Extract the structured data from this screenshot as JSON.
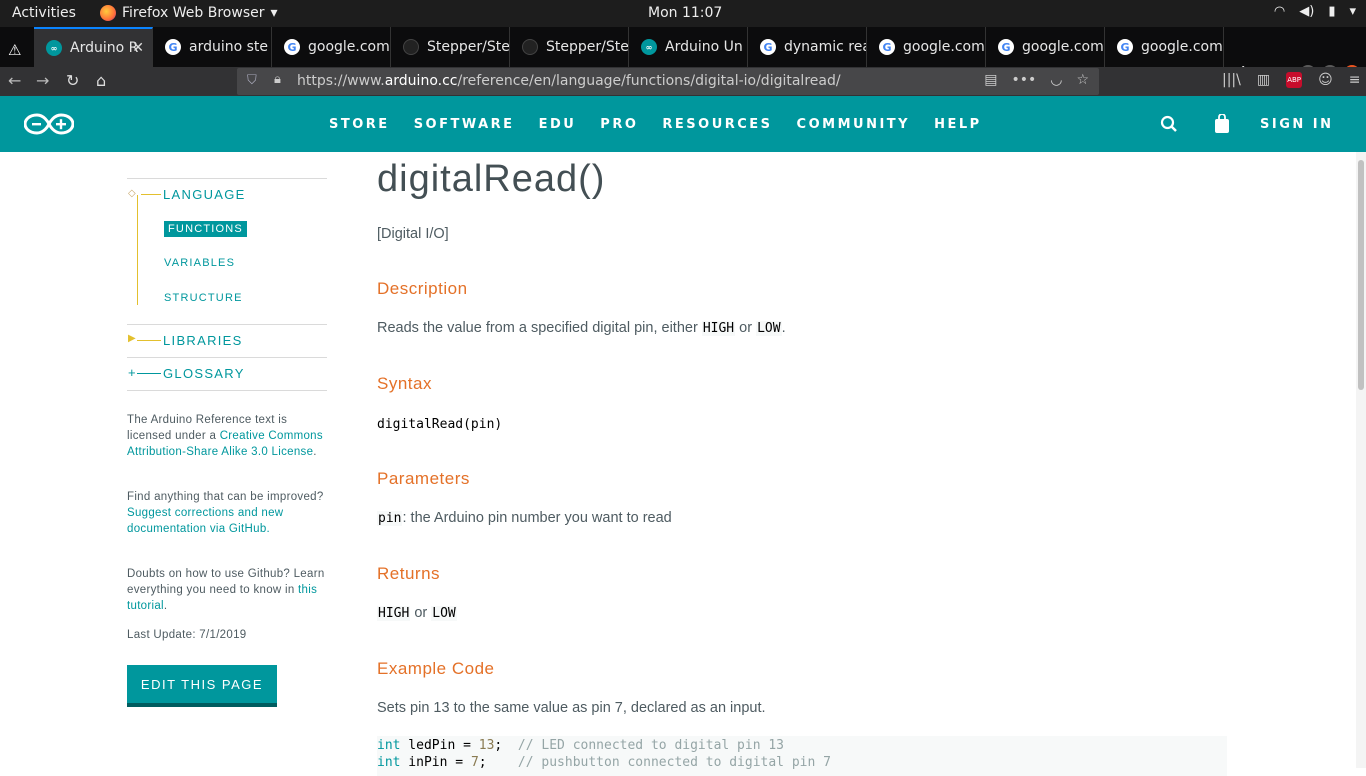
{
  "system_bar": {
    "activities": "Activities",
    "app_name": "Firefox Web Browser",
    "clock": "Mon 11:07"
  },
  "tabs": [
    {
      "label": "Arduino R",
      "favicon": "arduino",
      "active": true
    },
    {
      "label": "arduino ste",
      "favicon": "google"
    },
    {
      "label": "google.com",
      "favicon": "google"
    },
    {
      "label": "Stepper/Ste",
      "favicon": "github"
    },
    {
      "label": "Stepper/Ste",
      "favicon": "github"
    },
    {
      "label": "Arduino Un",
      "favicon": "arduino"
    },
    {
      "label": "dynamic rea",
      "favicon": "google"
    },
    {
      "label": "google.com",
      "favicon": "google"
    },
    {
      "label": "google.com",
      "favicon": "google"
    },
    {
      "label": "google.com",
      "favicon": "google"
    }
  ],
  "urlbar": {
    "prefix": "https://www.",
    "domain": "arduino.cc",
    "path": "/reference/en/language/functions/digital-io/digitalread/"
  },
  "site_nav": {
    "items": [
      "STORE",
      "SOFTWARE",
      "EDU",
      "PRO",
      "RESOURCES",
      "COMMUNITY",
      "HELP"
    ],
    "sign_in": "SIGN IN"
  },
  "sidebar": {
    "language": "LANGUAGE",
    "functions": "FUNCTIONS",
    "variables": "VARIABLES",
    "structure": "STRUCTURE",
    "libraries": "LIBRARIES",
    "glossary": "GLOSSARY",
    "license_text": "The Arduino Reference text is licensed under a ",
    "license_link": "Creative Commons Attribution-Share Alike 3.0 License",
    "license_end": ".",
    "find_text": "Find anything that can be improved? ",
    "find_link": "Suggest corrections and new documentation via GitHub.",
    "doubts_text": "Doubts on how to use Github? Learn everything you need to know in ",
    "doubts_link": "this tutorial",
    "doubts_end": ".",
    "last_update": "Last Update: 7/1/2019",
    "edit_button": "EDIT THIS PAGE"
  },
  "content": {
    "title": "digitalRead()",
    "category": "[Digital I/O]",
    "description_heading": "Description",
    "description_pre": "Reads the value from a specified digital pin, either ",
    "description_high": "HIGH",
    "description_or": " or ",
    "description_low": "LOW",
    "description_end": ".",
    "syntax_heading": "Syntax",
    "syntax_code": "digitalRead(pin)",
    "parameters_heading": "Parameters",
    "param_name": "pin",
    "param_desc": ": the Arduino pin number you want to read",
    "returns_heading": "Returns",
    "returns_high": "HIGH",
    "returns_or": " or ",
    "returns_low": "LOW",
    "example_heading": "Example Code",
    "example_desc": "Sets pin 13 to the same value as pin 7, declared as an input.",
    "code_lines": [
      {
        "kw": "int",
        "var": " ledPin = ",
        "num": "13",
        "rest": ";  ",
        "comment": "// LED connected to digital pin 13"
      },
      {
        "kw": "int",
        "var": " inPin = ",
        "num": "7",
        "rest": ";    ",
        "comment": "// pushbutton connected to digital pin 7"
      }
    ]
  }
}
